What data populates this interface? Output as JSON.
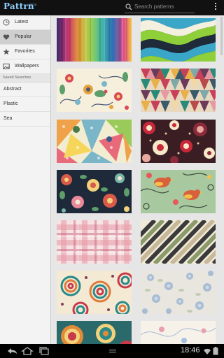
{
  "app": {
    "logo": "Pattrn",
    "beta": "BETA"
  },
  "search": {
    "placeholder": "Search patterns"
  },
  "sidebar": {
    "items": [
      {
        "label": "Latest",
        "icon": "clock-icon",
        "active": false
      },
      {
        "label": "Popular",
        "icon": "heart-icon",
        "active": true
      },
      {
        "label": "Favorites",
        "icon": "star-icon",
        "active": false
      },
      {
        "label": "Wallpapers",
        "icon": "image-icon",
        "active": false
      }
    ],
    "saved_searches_header": "Saved Searches",
    "saved_searches": [
      "Abstract",
      "Plastic",
      "Sea"
    ]
  },
  "tiles": [
    {
      "name": "rainbow-stripes"
    },
    {
      "name": "wavy-bands"
    },
    {
      "name": "floral-birds-cream"
    },
    {
      "name": "triangles"
    },
    {
      "name": "patchwork-triangles"
    },
    {
      "name": "red-flowers-dark"
    },
    {
      "name": "floral-dark-navy"
    },
    {
      "name": "birds-green"
    },
    {
      "name": "pink-plaid"
    },
    {
      "name": "diagonal-stripes"
    },
    {
      "name": "paisley-swirls"
    },
    {
      "name": "blue-flowers-light"
    },
    {
      "name": "teal-orange-medallions"
    },
    {
      "name": "floral-pale"
    }
  ],
  "status": {
    "time": "18:46"
  }
}
